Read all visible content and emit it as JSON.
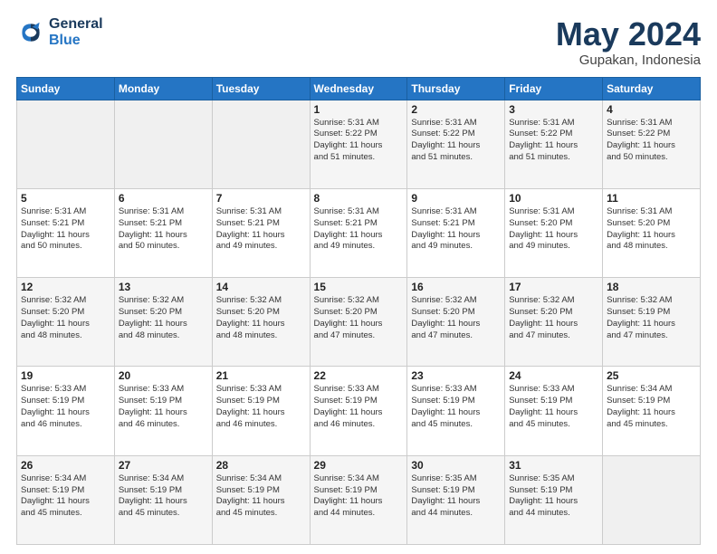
{
  "header": {
    "logo_line1": "General",
    "logo_line2": "Blue",
    "month": "May 2024",
    "location": "Gupakan, Indonesia"
  },
  "weekdays": [
    "Sunday",
    "Monday",
    "Tuesday",
    "Wednesday",
    "Thursday",
    "Friday",
    "Saturday"
  ],
  "weeks": [
    [
      {
        "day": "",
        "info": ""
      },
      {
        "day": "",
        "info": ""
      },
      {
        "day": "",
        "info": ""
      },
      {
        "day": "1",
        "info": "Sunrise: 5:31 AM\nSunset: 5:22 PM\nDaylight: 11 hours\nand 51 minutes."
      },
      {
        "day": "2",
        "info": "Sunrise: 5:31 AM\nSunset: 5:22 PM\nDaylight: 11 hours\nand 51 minutes."
      },
      {
        "day": "3",
        "info": "Sunrise: 5:31 AM\nSunset: 5:22 PM\nDaylight: 11 hours\nand 51 minutes."
      },
      {
        "day": "4",
        "info": "Sunrise: 5:31 AM\nSunset: 5:22 PM\nDaylight: 11 hours\nand 50 minutes."
      }
    ],
    [
      {
        "day": "5",
        "info": "Sunrise: 5:31 AM\nSunset: 5:21 PM\nDaylight: 11 hours\nand 50 minutes."
      },
      {
        "day": "6",
        "info": "Sunrise: 5:31 AM\nSunset: 5:21 PM\nDaylight: 11 hours\nand 50 minutes."
      },
      {
        "day": "7",
        "info": "Sunrise: 5:31 AM\nSunset: 5:21 PM\nDaylight: 11 hours\nand 49 minutes."
      },
      {
        "day": "8",
        "info": "Sunrise: 5:31 AM\nSunset: 5:21 PM\nDaylight: 11 hours\nand 49 minutes."
      },
      {
        "day": "9",
        "info": "Sunrise: 5:31 AM\nSunset: 5:21 PM\nDaylight: 11 hours\nand 49 minutes."
      },
      {
        "day": "10",
        "info": "Sunrise: 5:31 AM\nSunset: 5:20 PM\nDaylight: 11 hours\nand 49 minutes."
      },
      {
        "day": "11",
        "info": "Sunrise: 5:31 AM\nSunset: 5:20 PM\nDaylight: 11 hours\nand 48 minutes."
      }
    ],
    [
      {
        "day": "12",
        "info": "Sunrise: 5:32 AM\nSunset: 5:20 PM\nDaylight: 11 hours\nand 48 minutes."
      },
      {
        "day": "13",
        "info": "Sunrise: 5:32 AM\nSunset: 5:20 PM\nDaylight: 11 hours\nand 48 minutes."
      },
      {
        "day": "14",
        "info": "Sunrise: 5:32 AM\nSunset: 5:20 PM\nDaylight: 11 hours\nand 48 minutes."
      },
      {
        "day": "15",
        "info": "Sunrise: 5:32 AM\nSunset: 5:20 PM\nDaylight: 11 hours\nand 47 minutes."
      },
      {
        "day": "16",
        "info": "Sunrise: 5:32 AM\nSunset: 5:20 PM\nDaylight: 11 hours\nand 47 minutes."
      },
      {
        "day": "17",
        "info": "Sunrise: 5:32 AM\nSunset: 5:20 PM\nDaylight: 11 hours\nand 47 minutes."
      },
      {
        "day": "18",
        "info": "Sunrise: 5:32 AM\nSunset: 5:19 PM\nDaylight: 11 hours\nand 47 minutes."
      }
    ],
    [
      {
        "day": "19",
        "info": "Sunrise: 5:33 AM\nSunset: 5:19 PM\nDaylight: 11 hours\nand 46 minutes."
      },
      {
        "day": "20",
        "info": "Sunrise: 5:33 AM\nSunset: 5:19 PM\nDaylight: 11 hours\nand 46 minutes."
      },
      {
        "day": "21",
        "info": "Sunrise: 5:33 AM\nSunset: 5:19 PM\nDaylight: 11 hours\nand 46 minutes."
      },
      {
        "day": "22",
        "info": "Sunrise: 5:33 AM\nSunset: 5:19 PM\nDaylight: 11 hours\nand 46 minutes."
      },
      {
        "day": "23",
        "info": "Sunrise: 5:33 AM\nSunset: 5:19 PM\nDaylight: 11 hours\nand 45 minutes."
      },
      {
        "day": "24",
        "info": "Sunrise: 5:33 AM\nSunset: 5:19 PM\nDaylight: 11 hours\nand 45 minutes."
      },
      {
        "day": "25",
        "info": "Sunrise: 5:34 AM\nSunset: 5:19 PM\nDaylight: 11 hours\nand 45 minutes."
      }
    ],
    [
      {
        "day": "26",
        "info": "Sunrise: 5:34 AM\nSunset: 5:19 PM\nDaylight: 11 hours\nand 45 minutes."
      },
      {
        "day": "27",
        "info": "Sunrise: 5:34 AM\nSunset: 5:19 PM\nDaylight: 11 hours\nand 45 minutes."
      },
      {
        "day": "28",
        "info": "Sunrise: 5:34 AM\nSunset: 5:19 PM\nDaylight: 11 hours\nand 45 minutes."
      },
      {
        "day": "29",
        "info": "Sunrise: 5:34 AM\nSunset: 5:19 PM\nDaylight: 11 hours\nand 44 minutes."
      },
      {
        "day": "30",
        "info": "Sunrise: 5:35 AM\nSunset: 5:19 PM\nDaylight: 11 hours\nand 44 minutes."
      },
      {
        "day": "31",
        "info": "Sunrise: 5:35 AM\nSunset: 5:19 PM\nDaylight: 11 hours\nand 44 minutes."
      },
      {
        "day": "",
        "info": ""
      }
    ]
  ]
}
